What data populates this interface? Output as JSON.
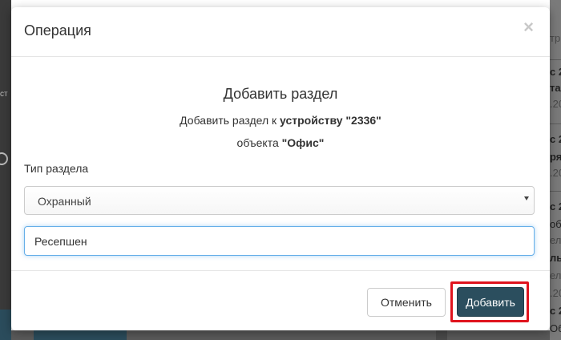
{
  "modal": {
    "title": "Операция",
    "close_symbol": "×"
  },
  "body": {
    "heading": "Добавить раздел",
    "line1_prefix": "Добавить раздел к ",
    "line1_bold": "устройству \"2336\"",
    "line2_prefix": "объекта ",
    "line2_bold": "\"Офис\"",
    "section_type_label": "Тип раздела",
    "section_type_selected": "Охранный",
    "name_input_value": "Ресепшен"
  },
  "footer": {
    "cancel_label": "Отменить",
    "add_label": "Добавить"
  },
  "background": {
    "left_fragment": "ст",
    "right_fragments": [
      "тр",
      "с 2",
      "тал",
      ".20",
      "с 2",
      "ряд",
      ".20",
      "с 2",
      "обр",
      "ел",
      "ль",
      "ел",
      ".20",
      "с 2",
      "Обрабо"
    ]
  },
  "colors": {
    "primary_button": "#2b4e5e",
    "highlight_frame": "#e0141e",
    "input_focus": "#66afe9"
  },
  "icons": {
    "close": "close-icon",
    "dropdown": "chevron-down-icon"
  }
}
